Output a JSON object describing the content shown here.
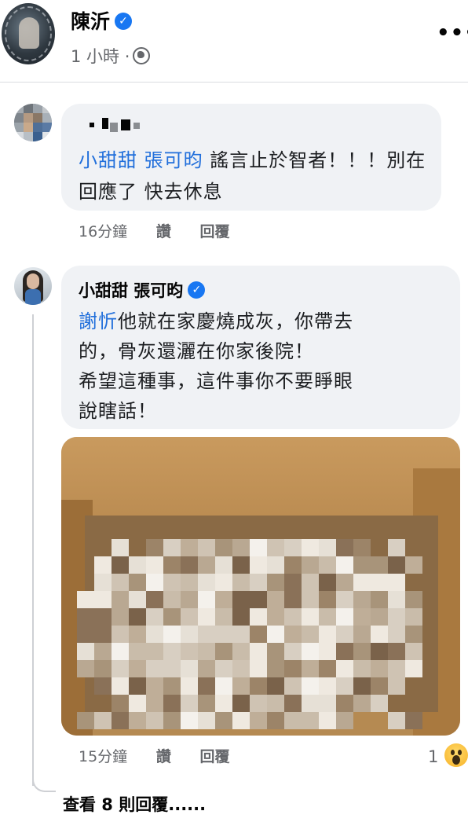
{
  "post": {
    "author_name": "陳沂",
    "time": "1 小時 ·",
    "verified": true,
    "more_icon": "more-horizontal-icon",
    "privacy_icon": "globe-icon"
  },
  "comments": [
    {
      "author_name": "",
      "mention": "小甜甜 張可昀",
      "text": " 謠言止於智者！！！別在回應了 快去休息",
      "time": "16分鐘",
      "like_label": "讚",
      "reply_label": "回覆"
    },
    {
      "author_name": "小甜甜 張可昀",
      "verified": true,
      "mention": "謝忻",
      "lines": [
        "他就在家慶燒成灰，你帶去",
        "的，骨灰還灑在你家後院！",
        "希望這種事，這件事你不要睜眼",
        "說瞎話！"
      ],
      "time": "15分鐘",
      "like_label": "讚",
      "reply_label": "回覆",
      "reaction_count": "1",
      "reaction_icon": "wow-reaction-icon",
      "photo_icon": "pixelated-photo"
    }
  ],
  "view_replies": "查看 8 則回覆......",
  "colors": {
    "mention": "#216fdb",
    "bubble": "#f0f2f5",
    "verified": "#1877f2",
    "meta": "#65676b"
  }
}
